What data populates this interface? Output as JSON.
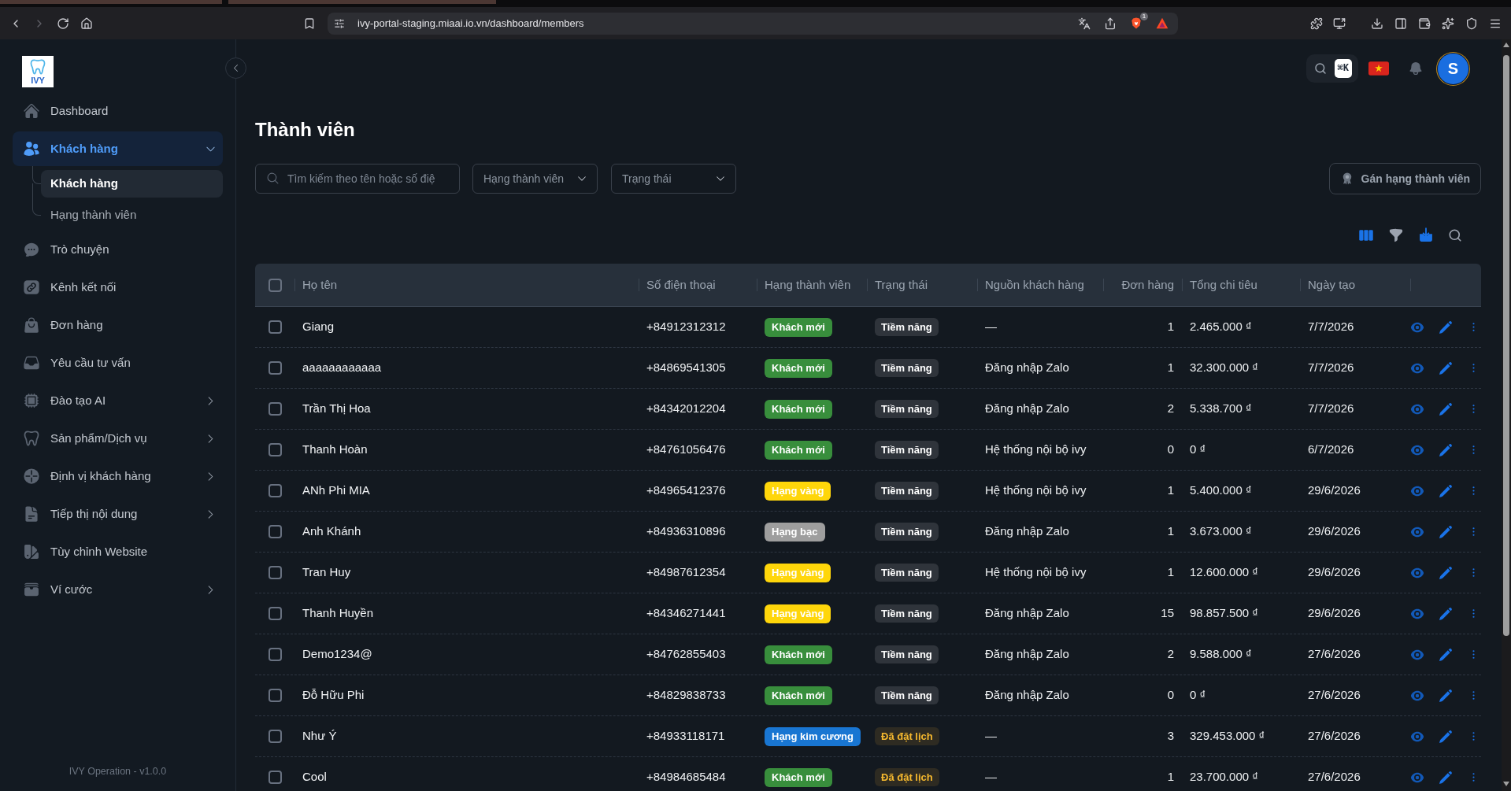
{
  "browser": {
    "url": "ivy-portal-staging.miaai.io.vn/dashboard/members",
    "shields_count": "1"
  },
  "sidebar": {
    "logo": "IVY",
    "items": [
      {
        "label": "Dashboard",
        "kind": "link",
        "selected": false
      },
      {
        "label": "Khách hàng",
        "kind": "group",
        "selected": true,
        "expanded": true,
        "children": [
          {
            "label": "Khách hàng",
            "selected": true
          },
          {
            "label": "Hạng thành viên",
            "selected": false
          }
        ]
      },
      {
        "label": "Trò chuyện",
        "kind": "link",
        "selected": false
      },
      {
        "label": "Kênh kết nối",
        "kind": "link",
        "selected": false
      },
      {
        "label": "Đơn hàng",
        "kind": "link",
        "selected": false
      },
      {
        "label": "Yêu cầu tư vấn",
        "kind": "link",
        "selected": false
      },
      {
        "label": "Đào tạo AI",
        "kind": "group",
        "selected": false,
        "expanded": false
      },
      {
        "label": "Sản phẩm/Dịch vụ",
        "kind": "group",
        "selected": false,
        "expanded": false
      },
      {
        "label": "Định vị khách hàng",
        "kind": "group",
        "selected": false,
        "expanded": false
      },
      {
        "label": "Tiếp thị nội dung",
        "kind": "group",
        "selected": false,
        "expanded": false
      },
      {
        "label": "Tùy chỉnh Website",
        "kind": "link",
        "selected": false
      },
      {
        "label": "Ví cước",
        "kind": "group",
        "selected": false,
        "expanded": false
      }
    ],
    "footer": "IVY Operation - v1.0.0"
  },
  "topbar": {
    "shortcut": "⌘K",
    "avatar_initial": "S"
  },
  "page": {
    "title": "Thành viên"
  },
  "filters": {
    "search": {
      "placeholder": "Tìm kiếm theo tên hoặc số điệ"
    },
    "tier": {
      "placeholder": "Hạng thành viên"
    },
    "status": {
      "placeholder": "Trạng thái"
    },
    "assign_button": "Gán hạng thành viên"
  },
  "table": {
    "header_checkbox": {
      "checked": false
    },
    "columns": [
      "Họ tên",
      "Số điện thoại",
      "Hạng thành viên",
      "Trạng thái",
      "Nguồn khách hàng",
      "Đơn hàng",
      "Tổng chi tiêu",
      "Ngày tạo"
    ],
    "rows": [
      {
        "checked": false,
        "name": "Giang",
        "phone": "+84912312312",
        "tier": {
          "label": "Khách mới",
          "color": "#388e3c"
        },
        "status": {
          "label": "Tiềm năng",
          "color": "#ffffff"
        },
        "source": "—",
        "orders": "1",
        "total": "2.465.000 ₫",
        "created": "7/7/2026"
      },
      {
        "checked": false,
        "name": "aaaaaaaaaaaa",
        "phone": "+84869541305",
        "tier": {
          "label": "Khách mới",
          "color": "#388e3c"
        },
        "status": {
          "label": "Tiềm năng",
          "color": "#ffffff"
        },
        "source": "Đăng nhập Zalo",
        "orders": "1",
        "total": "32.300.000 ₫",
        "created": "7/7/2026"
      },
      {
        "checked": false,
        "name": "Trần Thị Hoa",
        "phone": "+84342012204",
        "tier": {
          "label": "Khách mới",
          "color": "#388e3c"
        },
        "status": {
          "label": "Tiềm năng",
          "color": "#ffffff"
        },
        "source": "Đăng nhập Zalo",
        "orders": "2",
        "total": "5.338.700 ₫",
        "created": "7/7/2026"
      },
      {
        "checked": false,
        "name": "Thanh Hoàn",
        "phone": "+84761056476",
        "tier": {
          "label": "Khách mới",
          "color": "#388e3c"
        },
        "status": {
          "label": "Tiềm năng",
          "color": "#ffffff"
        },
        "source": "Hệ thống nội bộ ivy",
        "orders": "0",
        "total": "0 ₫",
        "created": "6/7/2026"
      },
      {
        "checked": false,
        "name": "ANh Phi MIA",
        "phone": "+84965412376",
        "tier": {
          "label": "Hạng vàng",
          "color": "#ffd60a"
        },
        "status": {
          "label": "Tiềm năng",
          "color": "#ffffff"
        },
        "source": "Hệ thống nội bộ ivy",
        "orders": "1",
        "total": "5.400.000 ₫",
        "created": "29/6/2026"
      },
      {
        "checked": false,
        "name": "Anh Khánh",
        "phone": "+84936310896",
        "tier": {
          "label": "Hạng bạc",
          "color": "#9e9e9e"
        },
        "status": {
          "label": "Tiềm năng",
          "color": "#ffffff"
        },
        "source": "Đăng nhập Zalo",
        "orders": "1",
        "total": "3.673.000 ₫",
        "created": "29/6/2026"
      },
      {
        "checked": false,
        "name": "Tran Huy",
        "phone": "+84987612354",
        "tier": {
          "label": "Hạng vàng",
          "color": "#ffd60a"
        },
        "status": {
          "label": "Tiềm năng",
          "color": "#ffffff"
        },
        "source": "Hệ thống nội bộ ivy",
        "orders": "1",
        "total": "12.600.000 ₫",
        "created": "29/6/2026"
      },
      {
        "checked": false,
        "name": "Thanh Huyền",
        "phone": "+84346271441",
        "tier": {
          "label": "Hạng vàng",
          "color": "#ffd60a"
        },
        "status": {
          "label": "Tiềm năng",
          "color": "#ffffff"
        },
        "source": "Đăng nhập Zalo",
        "orders": "15",
        "total": "98.857.500 ₫",
        "created": "29/6/2026"
      },
      {
        "checked": false,
        "name": "Demo1234@",
        "phone": "+84762855403",
        "tier": {
          "label": "Khách mới",
          "color": "#388e3c"
        },
        "status": {
          "label": "Tiềm năng",
          "color": "#ffffff"
        },
        "source": "Đăng nhập Zalo",
        "orders": "2",
        "total": "9.588.000 ₫",
        "created": "27/6/2026"
      },
      {
        "checked": false,
        "name": "Đỗ Hữu Phi",
        "phone": "+84829838733",
        "tier": {
          "label": "Khách mới",
          "color": "#388e3c"
        },
        "status": {
          "label": "Tiềm năng",
          "color": "#ffffff"
        },
        "source": "Đăng nhập Zalo",
        "orders": "0",
        "total": "0 ₫",
        "created": "27/6/2026"
      },
      {
        "checked": false,
        "name": "Như Ý",
        "phone": "+84933118171",
        "tier": {
          "label": "Hạng kim cương",
          "color": "#1976d2"
        },
        "status": {
          "label": "Đã đặt lịch",
          "color": "#f5b82e"
        },
        "source": "—",
        "orders": "3",
        "total": "329.453.000 ₫",
        "created": "27/6/2026"
      },
      {
        "checked": false,
        "name": "Cool",
        "phone": "+84984685484",
        "tier": {
          "label": "Khách mới",
          "color": "#388e3c"
        },
        "status": {
          "label": "Đã đặt lịch",
          "color": "#f5b82e"
        },
        "source": "—",
        "orders": "1",
        "total": "23.700.000 ₫",
        "created": "27/6/2026"
      }
    ]
  }
}
